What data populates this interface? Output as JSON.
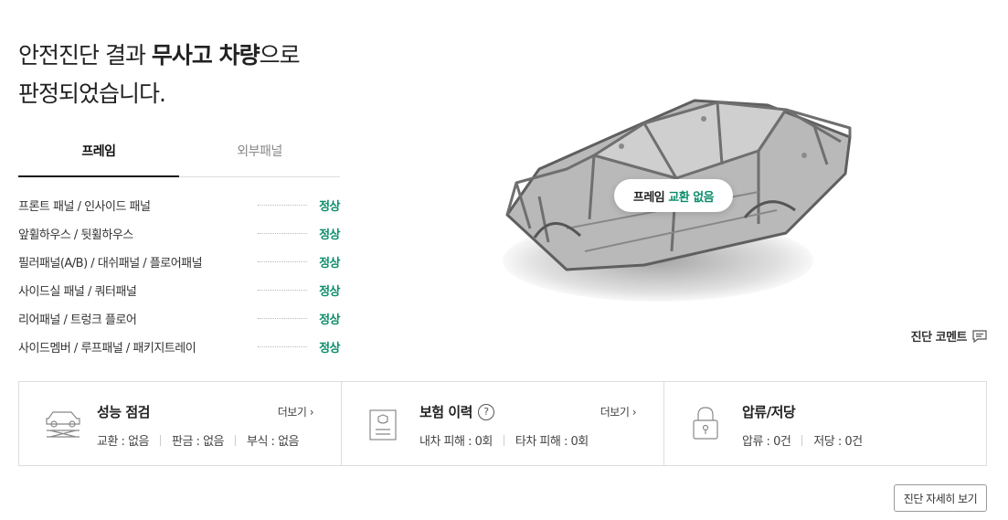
{
  "headline": {
    "line1_pre": "안전진단 결과 ",
    "line1_bold": "무사고 차량",
    "line1_post": "으로",
    "line2": "판정되었습니다."
  },
  "tabs": [
    {
      "label": "프레임",
      "active": true
    },
    {
      "label": "외부패널",
      "active": false
    }
  ],
  "parts": [
    {
      "name": "프론트 패널 / 인사이드 패널",
      "status": "정상"
    },
    {
      "name": "앞휠하우스 / 뒷휠하우스",
      "status": "정상"
    },
    {
      "name": "필러패널(A/B) / 대쉬패널 / 플로어패널",
      "status": "정상"
    },
    {
      "name": "사이드실 패널 / 쿼터패널",
      "status": "정상"
    },
    {
      "name": "리어패널 / 트렁크 플로어",
      "status": "정상"
    },
    {
      "name": "사이드멤버 / 루프패널 / 패키지트레이",
      "status": "정상"
    }
  ],
  "frame_bubble": {
    "label": "프레임",
    "result": "교환 없음"
  },
  "comment_link": "진단 코멘트",
  "cards": {
    "performance": {
      "title": "성능 점검",
      "more": "더보기 ›",
      "stats": [
        "교환 : 없음",
        "판금 : 없음",
        "부식 : 없음"
      ]
    },
    "insurance": {
      "title": "보험 이력",
      "help": "?",
      "more": "더보기 ›",
      "stats": [
        "내차 피해 : 0회",
        "타차 피해 : 0회"
      ]
    },
    "lien": {
      "title": "압류/저당",
      "stats": [
        "압류 : 0건",
        "저당 : 0건"
      ]
    }
  },
  "detail_button": "진단 자세히 보기",
  "colors": {
    "accent_green": "#0c8d6a",
    "text_dark": "#222222",
    "border": "#dddddd"
  }
}
